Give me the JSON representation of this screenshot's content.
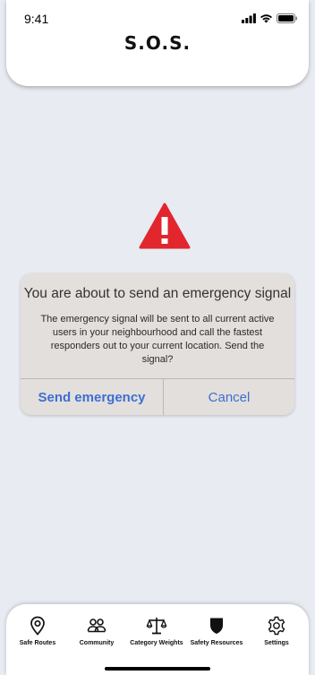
{
  "status_bar": {
    "time": "9:41"
  },
  "header": {
    "title": "S.O.S."
  },
  "dialog": {
    "title": "You are about to send an emergency signal",
    "message": "The emergency signal will be sent to all current active users in your neighbourhood and call the fastest responders out to your current location. Send the signal?",
    "confirm_label": "Send emergency",
    "cancel_label": "Cancel"
  },
  "tab_bar": {
    "items": [
      {
        "label": "Safe Routes",
        "icon": "location-pin-icon"
      },
      {
        "label": "Community",
        "icon": "people-icon"
      },
      {
        "label": "Category Weights",
        "icon": "scale-icon"
      },
      {
        "label": "Safety Resources",
        "icon": "shield-icon"
      },
      {
        "label": "Settings",
        "icon": "gear-icon"
      }
    ]
  },
  "colors": {
    "background": "#e8ebf1",
    "accent": "#3d6fd3",
    "warning": "#e1262d",
    "dialog": "#e3dfdc"
  }
}
